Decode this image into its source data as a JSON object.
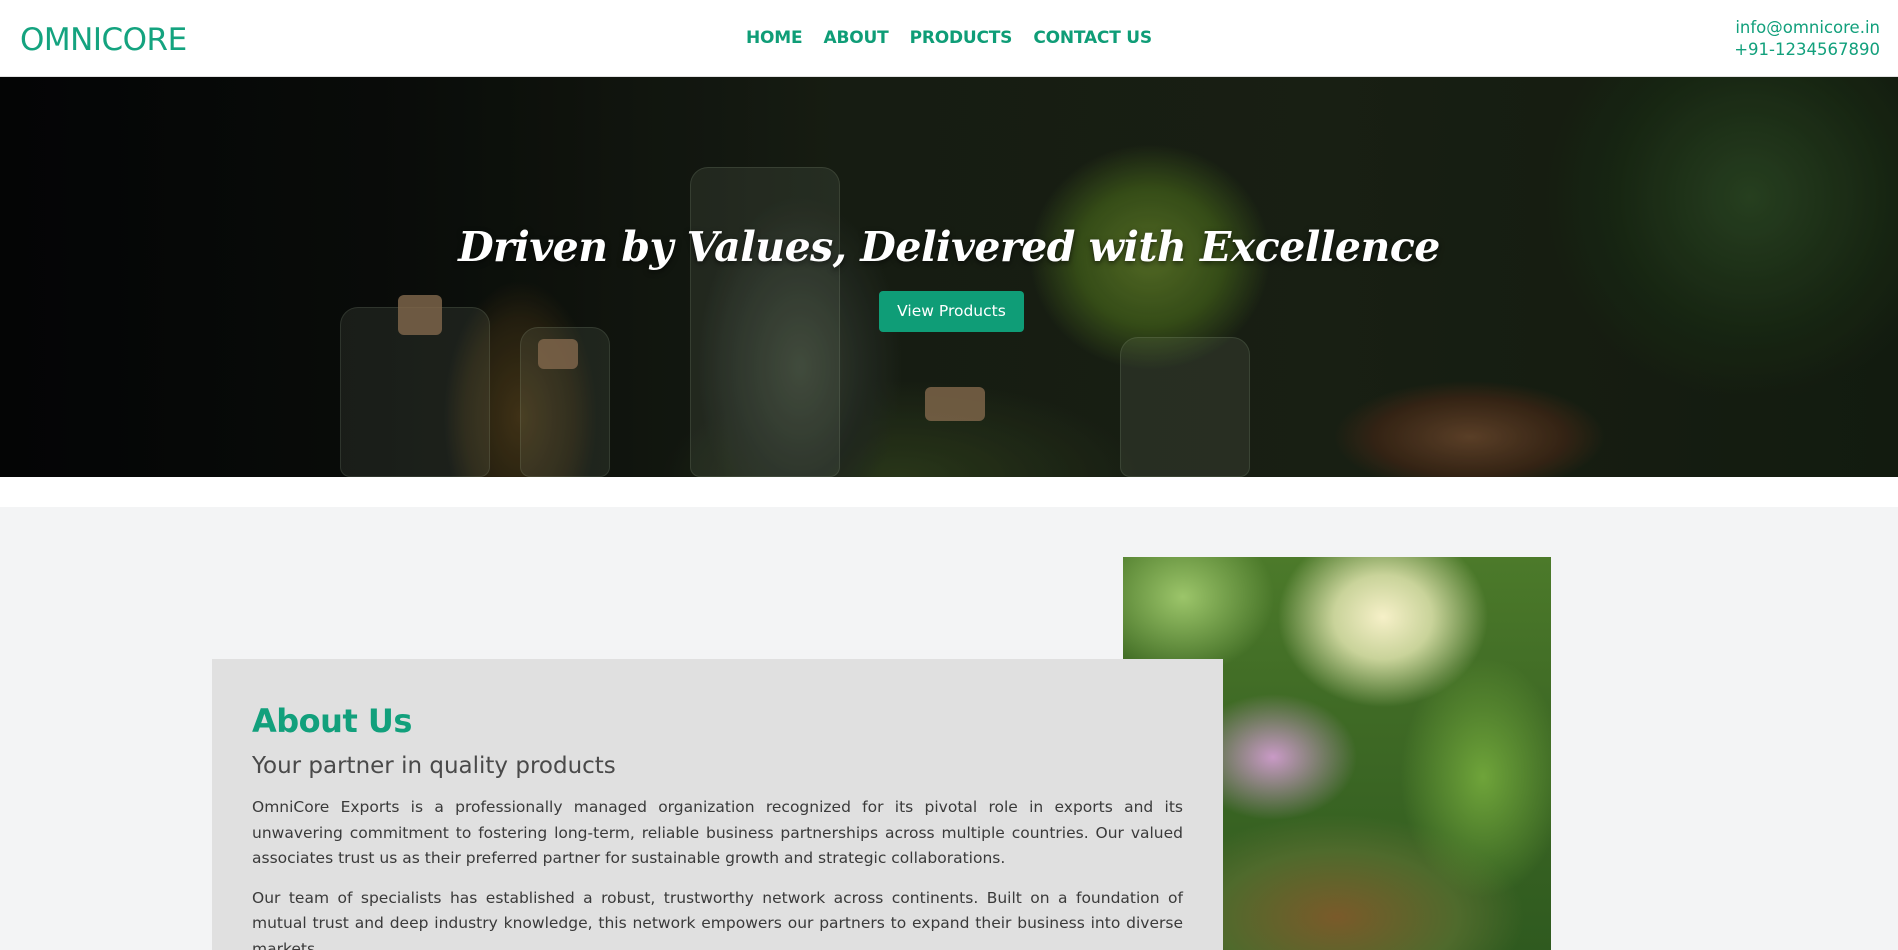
{
  "header": {
    "logo": "OMNICORE",
    "nav": [
      "HOME",
      "ABOUT",
      "PRODUCTS",
      "CONTACT US"
    ],
    "contact_email": "info@omnicore.in",
    "contact_phone": "+91-1234567890"
  },
  "hero": {
    "title": "Driven by Values, Delivered with Excellence",
    "button_label": "View Products"
  },
  "about": {
    "title": "About Us",
    "subtitle": "Your partner in quality products",
    "paragraphs": [
      "OmniCore Exports is a professionally managed organization recognized for its pivotal role in exports and its unwavering commitment to fostering long-term, reliable business partnerships across multiple countries. Our valued associates trust us as their preferred partner for sustainable growth and strategic collaborations.",
      "Our team of specialists has established a robust, trustworthy network across continents. Built on a foundation of mutual trust and deep industry knowledge, this network empowers our partners to expand their business into diverse markets"
    ]
  },
  "colors": {
    "brand_green": "#0f9d77",
    "about_bg": "#f3f4f5",
    "card_bg": "#e0e0e0"
  }
}
